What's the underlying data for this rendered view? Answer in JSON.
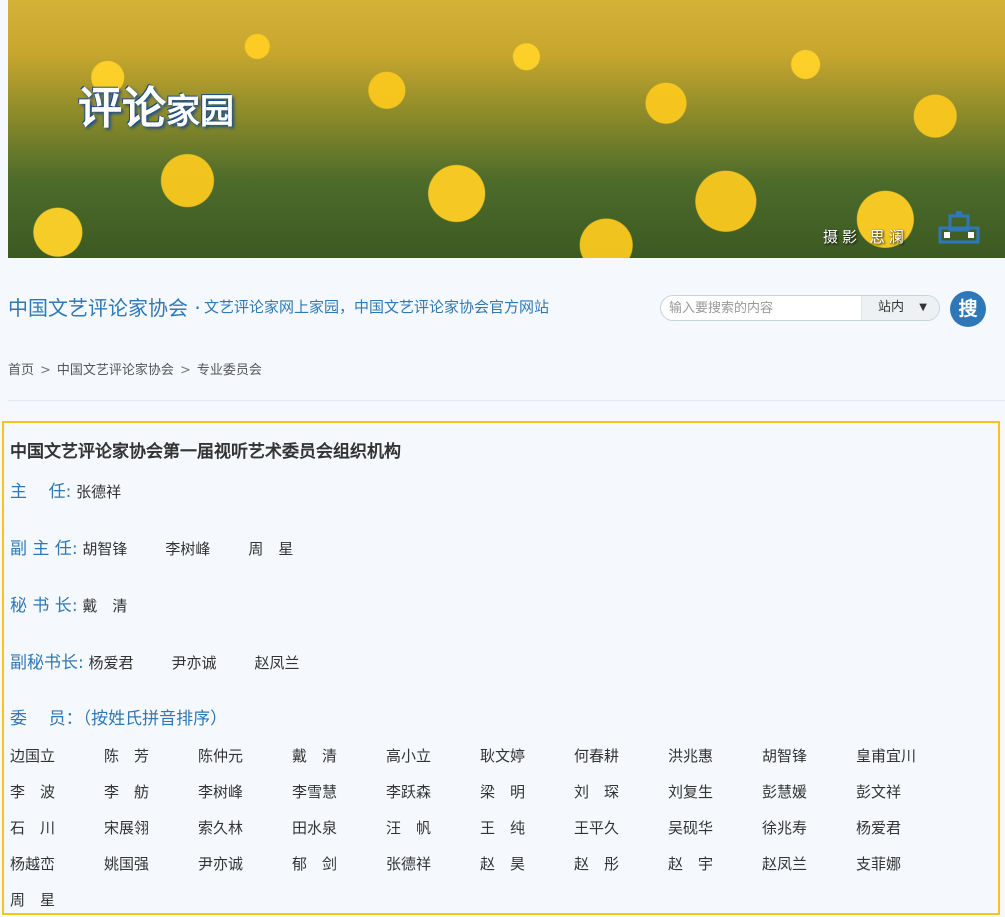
{
  "banner": {
    "title_big": "评论",
    "title_small": "家园",
    "credit": "摄影 思澜"
  },
  "header": {
    "site_title": "中国文艺评论家协会 ·",
    "site_subtitle": "文艺评论家网上家园，中国文艺评论家协会官方网站",
    "search_placeholder": "输入要搜索的内容",
    "search_scope": "站内",
    "search_button": "搜"
  },
  "breadcrumb": [
    "首页",
    "中国文艺评论家协会",
    "专业委员会"
  ],
  "content": {
    "title": "中国文艺评论家协会第一届视听艺术委员会组织机构",
    "roles": [
      {
        "label": "主    任",
        "names": [
          "张德祥"
        ]
      },
      {
        "label": "副 主 任",
        "names": [
          "胡智锋",
          "李树峰",
          "周　星"
        ]
      },
      {
        "label": "秘 书 长",
        "names": [
          "戴　清"
        ]
      },
      {
        "label": "副秘书长",
        "names": [
          "杨爱君",
          "尹亦诚",
          "赵凤兰"
        ]
      }
    ],
    "members_label": "委    员",
    "members_note": "（按姓氏拼音排序）",
    "members": [
      "边国立",
      "陈　芳",
      "陈仲元",
      "戴　清",
      "高小立",
      "耿文婷",
      "何春耕",
      "洪兆惠",
      "胡智锋",
      "皇甫宜川",
      "李　波",
      "李　舫",
      "李树峰",
      "李雪慧",
      "李跃森",
      "梁　明",
      "刘　琛",
      "刘复生",
      "彭慧媛",
      "彭文祥",
      "石　川",
      "宋展翎",
      "索久林",
      "田水泉",
      "汪　帆",
      "王　纯",
      "王平久",
      "吴砚华",
      "徐兆寿",
      "杨爱君",
      "杨越峦",
      "姚国强",
      "尹亦诚",
      "郁　剑",
      "张德祥",
      "赵　昊",
      "赵　彤",
      "赵　宇",
      "赵凤兰",
      "支菲娜",
      "周　星"
    ]
  }
}
